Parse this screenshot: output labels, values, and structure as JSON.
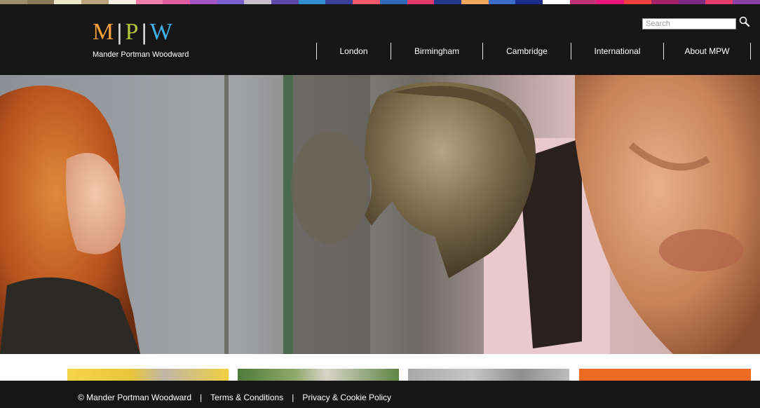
{
  "header": {
    "logo": {
      "letters": [
        "M",
        "P",
        "W"
      ],
      "letter_colors": [
        "#f6a13a",
        "#b5c53a",
        "#3fb0e8"
      ],
      "separator": "|",
      "company_name": "Mander Portman Woodward"
    },
    "search": {
      "placeholder": "Search",
      "value": "",
      "icon": "magnifier-icon"
    },
    "nav": [
      {
        "label": "London"
      },
      {
        "label": "Birmingham"
      },
      {
        "label": "Cambridge"
      },
      {
        "label": "International"
      },
      {
        "label": "About MPW"
      }
    ]
  },
  "stripe_colors": [
    "#9a8f6a",
    "#8b7a54",
    "#ece7c8",
    "#b8a37a",
    "#f4eee3",
    "#f27da9",
    "#e05ba0",
    "#a455c4",
    "#7a5fd0",
    "#c7c0cc",
    "#5d4aa8",
    "#2f8fd0",
    "#3a3f9c",
    "#f05a6a",
    "#2e68b7",
    "#e23a6b",
    "#21388f",
    "#f0a65b",
    "#3d6dcc",
    "#1a2a8a",
    "#ffffff",
    "#c4317b",
    "#e8157a",
    "#f04040",
    "#a12266",
    "#7d2a85",
    "#e53a6a",
    "#8a3fa8"
  ],
  "hero": {
    "image": "museum-photo-girl-and-bronze-head"
  },
  "tiles": [
    {
      "image": "student-photo-tile"
    },
    {
      "image": "campus-photo-tile"
    },
    {
      "image": "brochure-photo-tile"
    },
    {
      "image": "orange-promo-tile",
      "color": "#ef6a22"
    }
  ],
  "footer": {
    "copyright": "© Mander Portman Woodward",
    "separator": "|",
    "links": [
      "Terms & Conditions",
      "Privacy & Cookie Policy"
    ]
  }
}
